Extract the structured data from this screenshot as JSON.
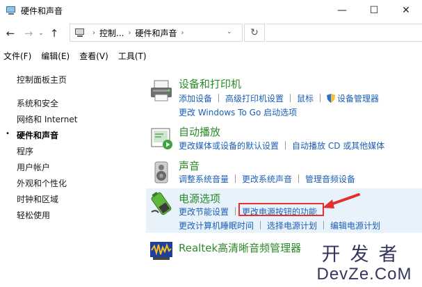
{
  "window": {
    "title": "硬件和声音",
    "minimize": "—",
    "maximize": "☐",
    "close": "✕"
  },
  "addressbar": {
    "back": "←",
    "forward": "→",
    "recent": "⌄",
    "up": "↑",
    "crumbs": [
      "控制...",
      "硬件和声音"
    ],
    "crumb_sep": "›",
    "dropdown": "⌄",
    "refresh": "↻"
  },
  "menubar": {
    "items": [
      "文件(F)",
      "编辑(E)",
      "查看(V)",
      "工具(T)"
    ]
  },
  "sidebar": {
    "home": "控制面板主页",
    "items": [
      "系统和安全",
      "网络和 Internet",
      "硬件和声音",
      "程序",
      "用户帐户",
      "外观和个性化",
      "时钟和区域",
      "轻松使用"
    ],
    "active_index": 2,
    "bullet": "•"
  },
  "categories": [
    {
      "title": "设备和打印机",
      "icon": "printer-icon",
      "rows": [
        [
          "添加设备",
          "高级打印机设置",
          "鼠标",
          "设备管理器"
        ],
        [
          "更改 Windows To Go 启动选项"
        ]
      ]
    },
    {
      "title": "自动播放",
      "icon": "autoplay-icon",
      "rows": [
        [
          "更改媒体或设备的默认设置",
          "自动播放 CD 或其他媒体"
        ]
      ]
    },
    {
      "title": "声音",
      "icon": "speaker-icon",
      "rows": [
        [
          "调整系统音量",
          "更改系统声音",
          "管理音频设备"
        ]
      ]
    },
    {
      "title": "电源选项",
      "icon": "battery-icon",
      "rows": [
        [
          "更改节能设置",
          "更改电源按钮的功能"
        ],
        [
          "更改计算机睡眠时间",
          "选择电源计划",
          "编辑电源计划"
        ]
      ]
    },
    {
      "title": "Realtek高清晰音频管理器",
      "icon": "realtek-audio-icon",
      "rows": []
    }
  ],
  "watermark": {
    "line1": "开发者",
    "line2": "DevZe.CoM"
  },
  "colors": {
    "category_title": "#2a8a2a",
    "link": "#1c5fb7",
    "highlight_bg": "#e8f2fb",
    "annotation_red": "#e53030"
  }
}
